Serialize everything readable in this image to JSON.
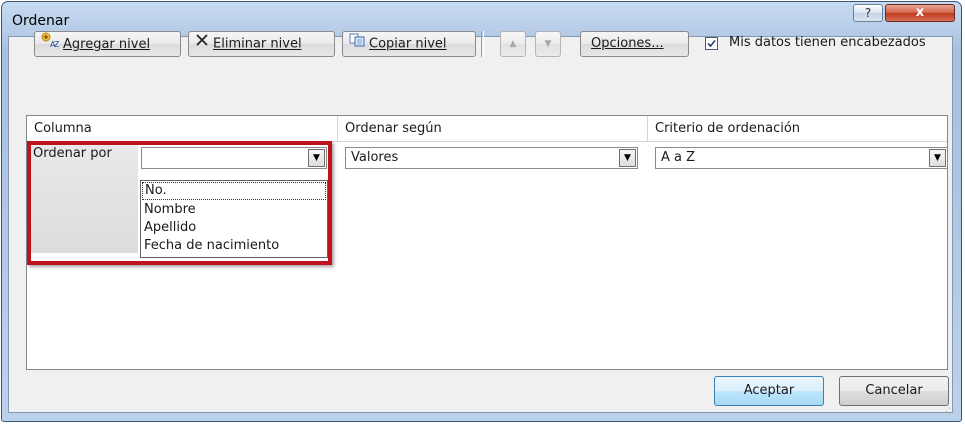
{
  "window": {
    "title": "Ordenar"
  },
  "titlebar": {
    "help_label": "?",
    "close_label": "x"
  },
  "toolbar": {
    "add_level": "Agregar nivel",
    "delete_level": "Eliminar nivel",
    "copy_level": "Copiar nivel",
    "move_up": "▲",
    "move_down": "▼",
    "options": "Opciones...",
    "has_headers_label": "Mis datos tienen encabezados",
    "has_headers_checked": true
  },
  "grid": {
    "headers": [
      "Columna",
      "Ordenar según",
      "Criterio de ordenación"
    ],
    "row": {
      "label": "Ordenar por",
      "column_value": "",
      "sort_on_value": "Valores",
      "order_value": "A a Z"
    }
  },
  "column_dropdown": {
    "options": [
      "No.",
      "Nombre",
      "Apellido",
      "Fecha de nacimiento"
    ]
  },
  "footer": {
    "ok": "Aceptar",
    "cancel": "Cancelar"
  },
  "colors": {
    "highlight": "#c0111f",
    "title_bar": "#b7cde8",
    "close_button": "#c0391d"
  }
}
